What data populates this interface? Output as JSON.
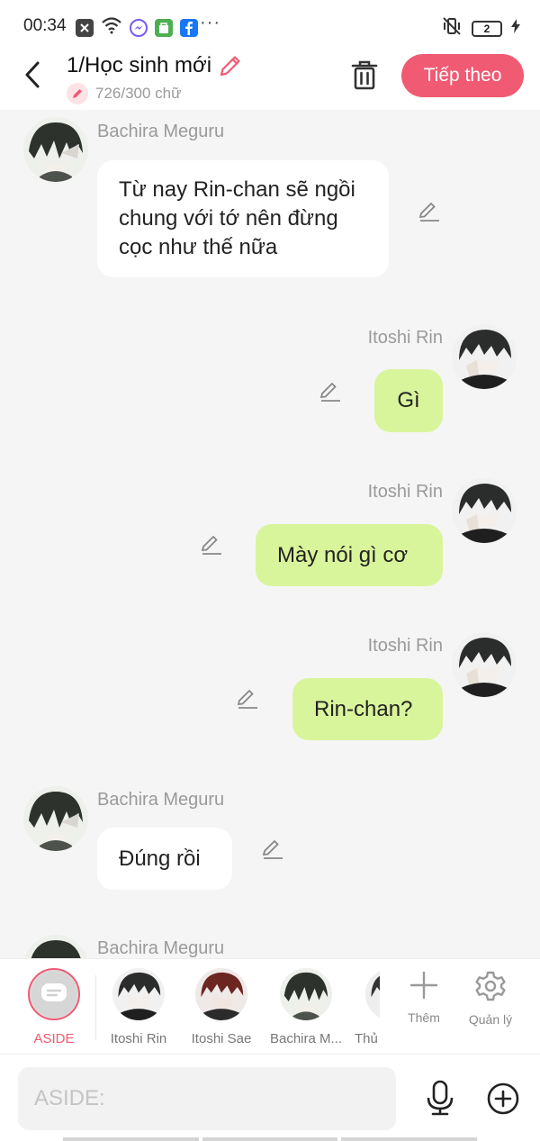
{
  "status_bar": {
    "time": "00:34",
    "dots": "···",
    "battery_level": "2",
    "icons": [
      "x-notification-icon",
      "wifi-icon",
      "messenger-icon",
      "store-icon",
      "facebook-icon",
      "vibrate-off-icon",
      "charging-icon"
    ],
    "colors": {
      "messenger": "#7a5cf0",
      "store": "#4caf50",
      "facebook": "#1877f2"
    }
  },
  "header": {
    "title": "1/Học sinh mới",
    "word_count": "726/300 chữ",
    "next_label": "Tiếp theo",
    "accent_color": "#f05a73"
  },
  "messages": [
    {
      "side": "left",
      "sender": "Bachira Meguru",
      "text": "Từ nay Rin-chan sẽ ngồi chung với tớ nên đừng cọc như thế nữa"
    },
    {
      "side": "right",
      "sender": "Itoshi Rin",
      "text": "Gì"
    },
    {
      "side": "right",
      "sender": "Itoshi Rin",
      "text": "Mày nói gì cơ"
    },
    {
      "side": "right",
      "sender": "Itoshi Rin",
      "text": "Rin-chan?"
    },
    {
      "side": "left",
      "sender": "Bachira Meguru",
      "text": "Đúng rồi"
    },
    {
      "side": "left",
      "sender": "Bachira Meguru",
      "text": ""
    }
  ],
  "characters": [
    {
      "name": "ASIDE"
    },
    {
      "name": "Itoshi Rin"
    },
    {
      "name": "Itoshi Sae"
    },
    {
      "name": "Bachira M..."
    },
    {
      "name": "Thủ"
    }
  ],
  "tools": {
    "add_label": "Thêm",
    "manage_label": "Quản lý"
  },
  "input": {
    "placeholder": "ASIDE:"
  }
}
